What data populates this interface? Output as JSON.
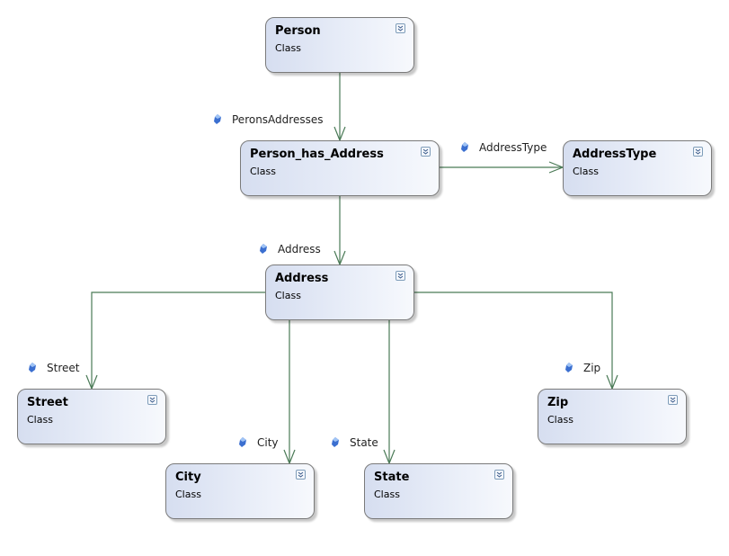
{
  "diagram": {
    "type": "class-diagram",
    "stroke_color": "#4a7a56",
    "classes": [
      {
        "id": "person",
        "name": "Person",
        "stereotype": "Class"
      },
      {
        "id": "person_has_address",
        "name": "Person_has_Address",
        "stereotype": "Class"
      },
      {
        "id": "addresstype",
        "name": "AddressType",
        "stereotype": "Class"
      },
      {
        "id": "address",
        "name": "Address",
        "stereotype": "Class"
      },
      {
        "id": "street",
        "name": "Street",
        "stereotype": "Class"
      },
      {
        "id": "city",
        "name": "City",
        "stereotype": "Class"
      },
      {
        "id": "state",
        "name": "State",
        "stereotype": "Class"
      },
      {
        "id": "zip",
        "name": "Zip",
        "stereotype": "Class"
      }
    ],
    "associations": [
      {
        "from": "person",
        "to": "person_has_address",
        "label": "PeronsAddresses",
        "icon": "property-icon"
      },
      {
        "from": "person_has_address",
        "to": "addresstype",
        "label": "AddressType",
        "icon": "property-icon"
      },
      {
        "from": "person_has_address",
        "to": "address",
        "label": "Address",
        "icon": "property-icon"
      },
      {
        "from": "address",
        "to": "street",
        "label": "Street",
        "icon": "property-icon"
      },
      {
        "from": "address",
        "to": "city",
        "label": "City",
        "icon": "property-icon"
      },
      {
        "from": "address",
        "to": "state",
        "label": "State",
        "icon": "property-icon"
      },
      {
        "from": "address",
        "to": "zip",
        "label": "Zip",
        "icon": "property-icon"
      }
    ]
  }
}
